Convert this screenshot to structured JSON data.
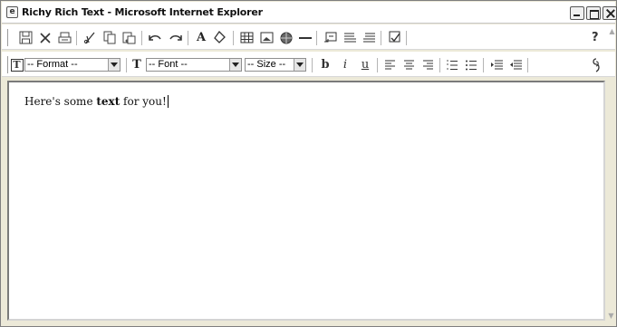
{
  "window": {
    "title": "Richy Rich Text - Microsoft Internet Explorer",
    "icon": "ie-icon",
    "controls": [
      "minimize",
      "maximize",
      "close"
    ]
  },
  "toolbar1": {
    "buttons": [
      {
        "name": "save",
        "icon": "disk-icon"
      },
      {
        "name": "delete",
        "icon": "x-icon"
      },
      {
        "name": "print",
        "icon": "printer-icon"
      },
      {
        "name": "cut",
        "icon": "scissors-icon"
      },
      {
        "name": "copy",
        "icon": "copy-icon"
      },
      {
        "name": "paste",
        "icon": "paste-icon"
      },
      {
        "name": "undo",
        "icon": "undo-icon"
      },
      {
        "name": "redo",
        "icon": "redo-icon"
      },
      {
        "name": "font-color",
        "icon": "letter-a-icon"
      },
      {
        "name": "highlight",
        "icon": "paint-bucket-icon"
      },
      {
        "name": "insert-table",
        "icon": "table-icon"
      },
      {
        "name": "insert-image",
        "icon": "image-icon"
      },
      {
        "name": "insert-link",
        "icon": "globe-icon"
      },
      {
        "name": "horizontal-rule",
        "icon": "hr-icon"
      },
      {
        "name": "insert-form",
        "icon": "form-icon"
      },
      {
        "name": "align-left-list",
        "icon": "list-icon"
      },
      {
        "name": "align-right-list",
        "icon": "list-right-icon"
      },
      {
        "name": "spellcheck",
        "icon": "spellcheck-icon"
      }
    ],
    "help_label": "?"
  },
  "toolbar2": {
    "format_select": {
      "value": "-- Format --"
    },
    "font_select": {
      "value": "-- Font --"
    },
    "size_select": {
      "value": "-- Size --"
    },
    "text_icon_label": "T",
    "bold_label": "b",
    "italic_label": "i",
    "underline_label": "u"
  },
  "editor": {
    "text_before": "Here's some ",
    "text_bold": "text",
    "text_after": " for you!"
  }
}
